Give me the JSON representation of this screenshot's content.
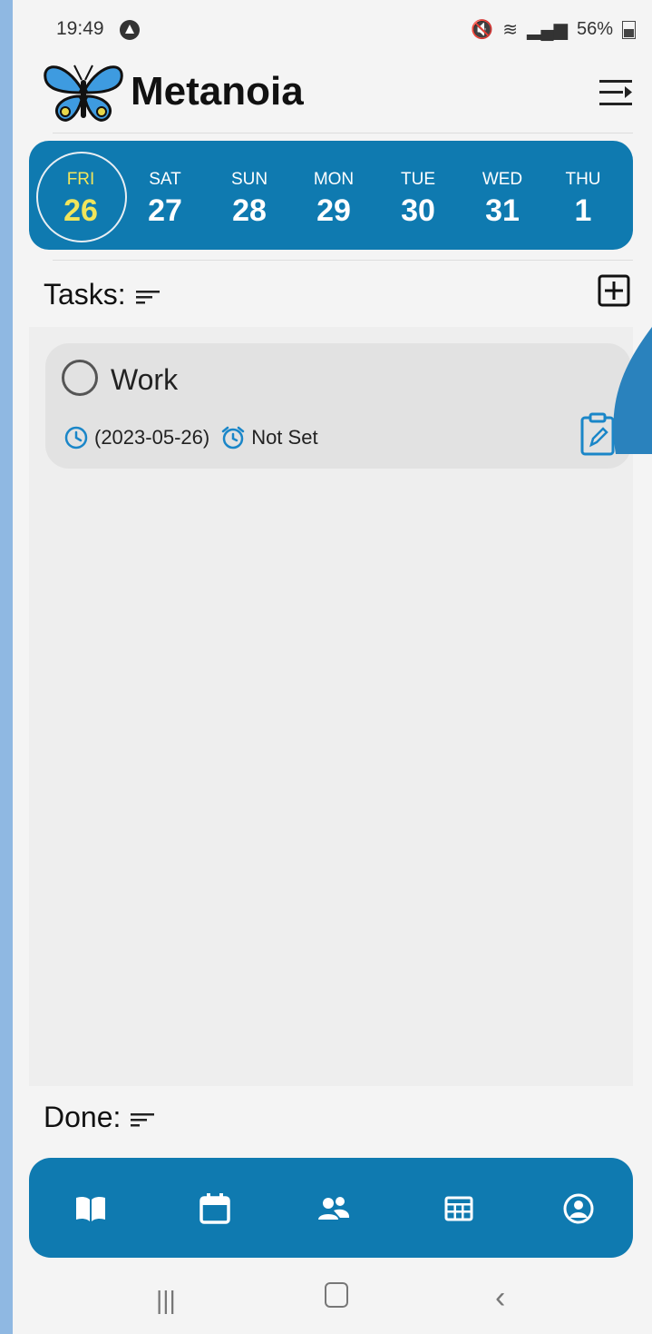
{
  "status": {
    "time": "19:49",
    "battery": "56%"
  },
  "app": {
    "title": "Metanoia"
  },
  "week": {
    "days": [
      {
        "name": "FRI",
        "num": "26",
        "selected": true
      },
      {
        "name": "SAT",
        "num": "27"
      },
      {
        "name": "SUN",
        "num": "28"
      },
      {
        "name": "MON",
        "num": "29"
      },
      {
        "name": "TUE",
        "num": "30"
      },
      {
        "name": "WED",
        "num": "31"
      },
      {
        "name": "THU",
        "num": "1"
      }
    ]
  },
  "tasks": {
    "label": "Tasks:",
    "items": [
      {
        "title": "Work",
        "date": "(2023-05-26)",
        "reminder": "Not Set"
      }
    ]
  },
  "done": {
    "label": "Done:"
  },
  "colors": {
    "accent": "#0f7ab0",
    "selected_day": "#f1e55b",
    "icon_blue": "#1a86c8"
  },
  "nav": [
    "book-icon",
    "calendar-icon",
    "people-icon",
    "grid-icon",
    "profile-icon"
  ]
}
